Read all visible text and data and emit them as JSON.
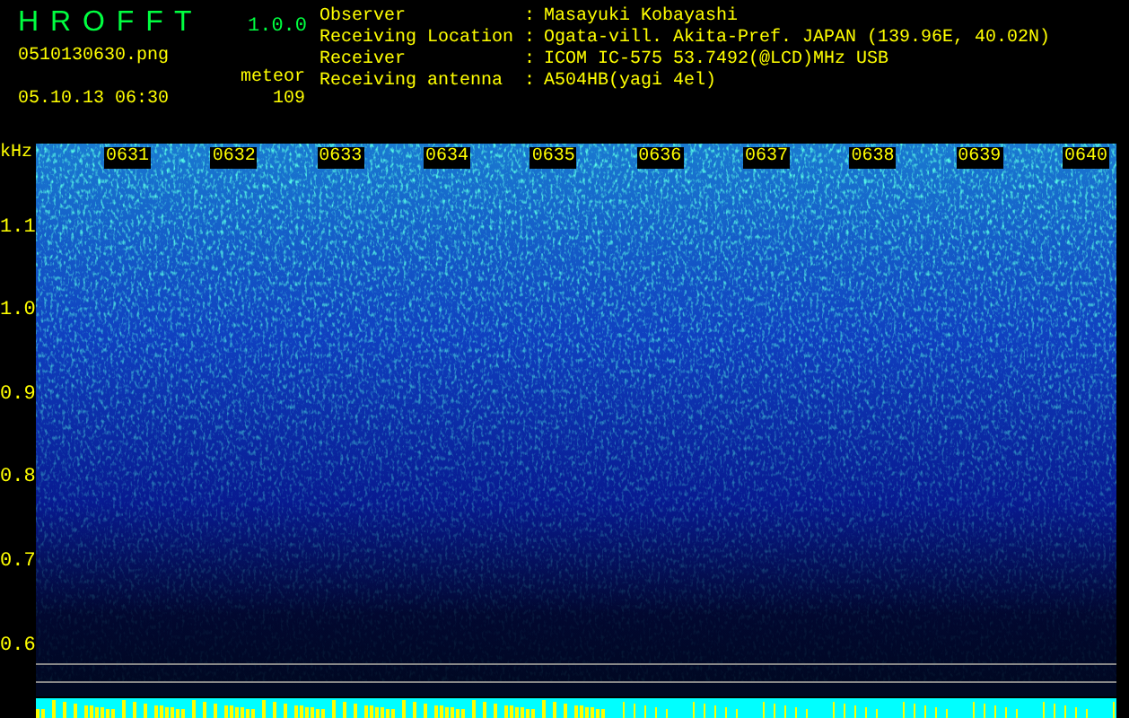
{
  "app": {
    "title": "H R O F F T",
    "version": "1.0.0",
    "filename": "0510130630.png",
    "datetime": "05.10.13 06:30",
    "counter_label": "meteor",
    "counter_value": "109"
  },
  "info": [
    {
      "label": "Observer",
      "sep": ":",
      "value": "Masayuki Kobayashi"
    },
    {
      "label": "Receiving Location",
      "sep": ":",
      "value": "Ogata-vill. Akita-Pref. JAPAN (139.96E, 40.02N)"
    },
    {
      "label": "Receiver",
      "sep": ":",
      "value": "ICOM IC-575 53.7492(@LCD)MHz USB"
    },
    {
      "label": "Receiving antenna",
      "sep": ":",
      "value": "A504HB(yagi 4el)"
    }
  ],
  "spectrogram": {
    "unit": "kHz",
    "y_labels": [
      "1.1",
      "1.0",
      "0.9",
      "0.8",
      "0.7",
      "0.6"
    ],
    "time_labels": [
      "0631",
      "0632",
      "0633",
      "0634",
      "0635",
      "0636",
      "0637",
      "0638",
      "0639",
      "0640"
    ]
  }
}
